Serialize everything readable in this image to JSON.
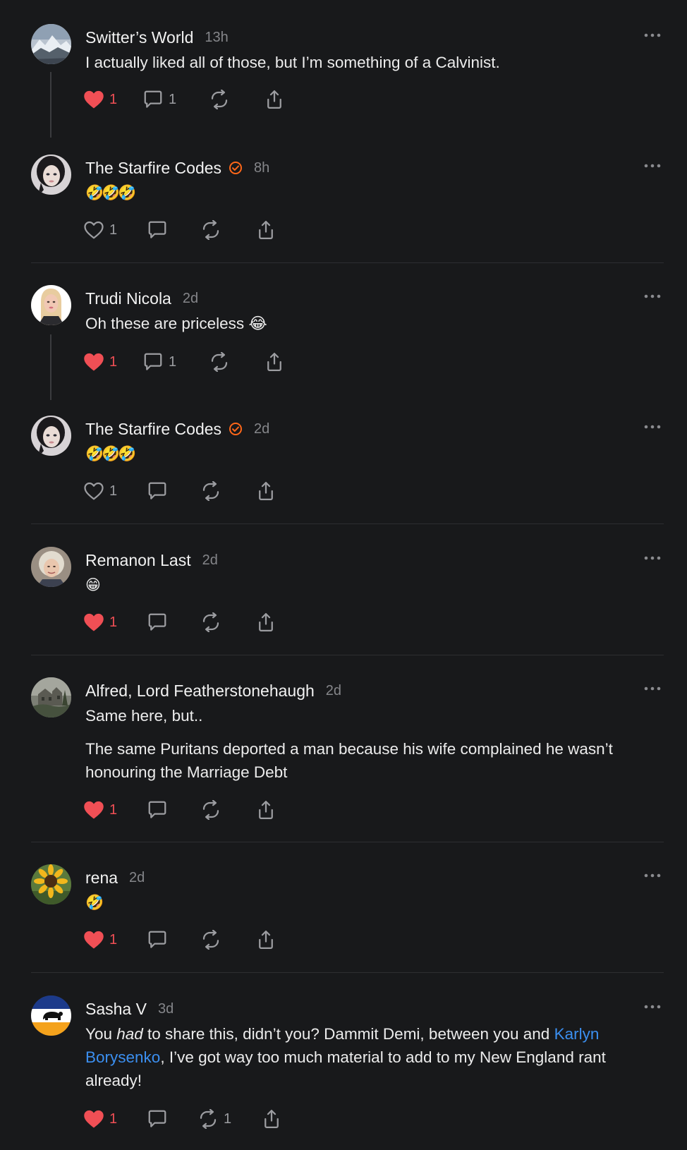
{
  "colors": {
    "background": "#18191b",
    "like_active": "#f04f55",
    "verified": "#ff6719",
    "mention_link": "#3b8ff0",
    "muted": "#85868a"
  },
  "comments": [
    {
      "author": "Switter’s World",
      "time": "13h",
      "verified": false,
      "avatar": "avatar-mountain",
      "text": "I actually liked all of those, but I’m something of a Calvinist.",
      "liked": true,
      "likes": "1",
      "replies": "1",
      "restacks": ""
    },
    {
      "author": "The Starfire Codes",
      "time": "8h",
      "verified": true,
      "avatar": "avatar-woman-dark-hair",
      "text": "🤣🤣🤣",
      "liked": false,
      "likes": "1",
      "replies": "",
      "restacks": ""
    },
    {
      "author": "Trudi Nicola",
      "time": "2d",
      "verified": false,
      "avatar": "avatar-woman-blonde",
      "text": "Oh these are priceless 😂",
      "liked": true,
      "likes": "1",
      "replies": "1",
      "restacks": ""
    },
    {
      "author": "The Starfire Codes",
      "time": "2d",
      "verified": true,
      "avatar": "avatar-woman-dark-hair",
      "text": "🤣🤣🤣",
      "liked": false,
      "likes": "1",
      "replies": "",
      "restacks": ""
    },
    {
      "author": "Remanon Last",
      "time": "2d",
      "verified": false,
      "avatar": "avatar-older-woman",
      "text": "😁",
      "liked": true,
      "likes": "1",
      "replies": "",
      "restacks": ""
    },
    {
      "author": "Alfred, Lord Featherstonehaugh",
      "time": "2d",
      "verified": false,
      "avatar": "avatar-manor-house",
      "paragraphs": [
        "Same here, but..",
        "The same Puritans deported a man because his wife complained he wasn’t honouring the Marriage Debt"
      ],
      "liked": true,
      "likes": "1",
      "replies": "",
      "restacks": ""
    },
    {
      "author": "rena",
      "time": "2d",
      "verified": false,
      "avatar": "avatar-sunflower",
      "text": "🤣",
      "liked": true,
      "likes": "1",
      "replies": "",
      "restacks": ""
    },
    {
      "author": "Sasha V",
      "time": "3d",
      "verified": false,
      "avatar": "avatar-bison-flag",
      "text_parts": {
        "before_em": "You ",
        "em": "had",
        "after_em": " to share this, didn’t you? Dammit Demi, between you and ",
        "mention": "Karlyn Borysenko",
        "after_mention": ", I’ve got way too much material to add to my New England rant already!"
      },
      "liked": true,
      "likes": "1",
      "replies": "",
      "restacks": "1"
    }
  ]
}
